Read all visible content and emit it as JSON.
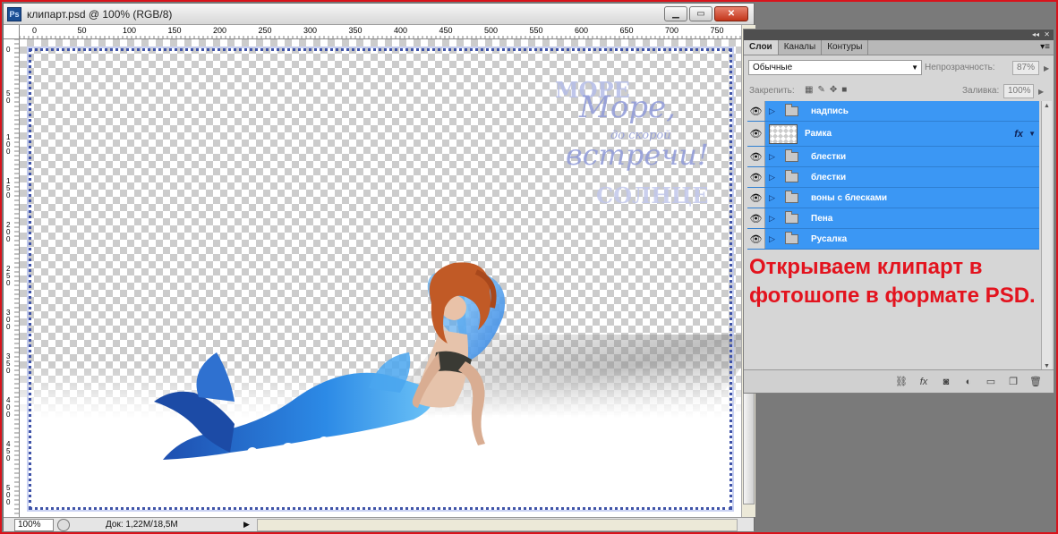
{
  "document": {
    "title": "клипарт.psd @ 100% (RGB/8)",
    "app_badge": "Ps",
    "window_buttons": {
      "minimize": "▁",
      "maximize": "▭",
      "close": "✕"
    },
    "ruler_top_labels": [
      "0",
      "50",
      "100",
      "150",
      "200",
      "250",
      "300",
      "350",
      "400",
      "450",
      "500",
      "550",
      "600",
      "650",
      "700",
      "750"
    ],
    "ruler_left_labels": [
      "0",
      "5 0",
      "1 0 0",
      "1 5 0",
      "2 0 0",
      "2 5 0",
      "3 0 0",
      "3 5 0",
      "4 0 0",
      "4 5 0",
      "5 0 0"
    ],
    "status": {
      "zoom": "100%",
      "doc_info": "Док: 1,22М/18,5М",
      "arrow": "▶"
    },
    "watermark": {
      "line1": "Море,",
      "line2": "до скорой",
      "line3": "встречи!",
      "top_word": "МОРЕ",
      "bottom_word": "СОЛНЦЕ"
    }
  },
  "layers_panel": {
    "tabs": [
      "Слои",
      "Каналы",
      "Контуры"
    ],
    "tab_menu": "▾≡",
    "blend_mode": "Обычные",
    "opacity_label": "Непрозрачность:",
    "opacity_value": "87%",
    "lock_label": "Закрепить:",
    "fill_label": "Заливка:",
    "fill_value": "100%",
    "layers": [
      {
        "name": "надпись",
        "type": "group"
      },
      {
        "name": "Рамка",
        "type": "layer",
        "fx": "fx"
      },
      {
        "name": "блестки",
        "type": "group"
      },
      {
        "name": "блестки",
        "type": "group"
      },
      {
        "name": "воны с блесками",
        "type": "group"
      },
      {
        "name": "Пена",
        "type": "group"
      },
      {
        "name": "Русалка",
        "type": "group"
      }
    ]
  },
  "annotation": {
    "text": "Открываем клипарт в фотошопе в формате PSD.",
    "color": "#e3131e"
  },
  "colors": {
    "selection_blue": "#3b97f4",
    "frame_red": "#d9131b"
  }
}
